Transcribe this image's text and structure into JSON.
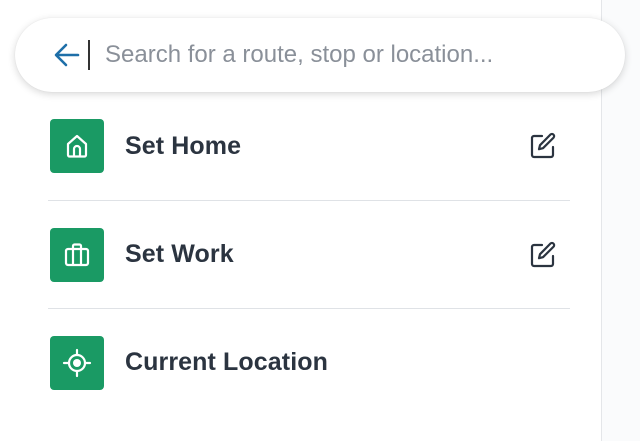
{
  "search": {
    "placeholder": "Search for a route, stop or location...",
    "value": ""
  },
  "icons": {
    "back": "arrow-left-icon",
    "home": "home-icon",
    "work": "briefcase-icon",
    "location": "crosshair-icon",
    "edit": "edit-icon"
  },
  "colors": {
    "accent": "#1a9a64",
    "back_arrow": "#1e6fa8",
    "text": "#2b3440",
    "placeholder": "#8a9099"
  },
  "items": [
    {
      "label": "Set Home",
      "icon": "home-icon",
      "editable": true
    },
    {
      "label": "Set Work",
      "icon": "briefcase-icon",
      "editable": true
    },
    {
      "label": "Current Location",
      "icon": "crosshair-icon",
      "editable": false
    }
  ]
}
